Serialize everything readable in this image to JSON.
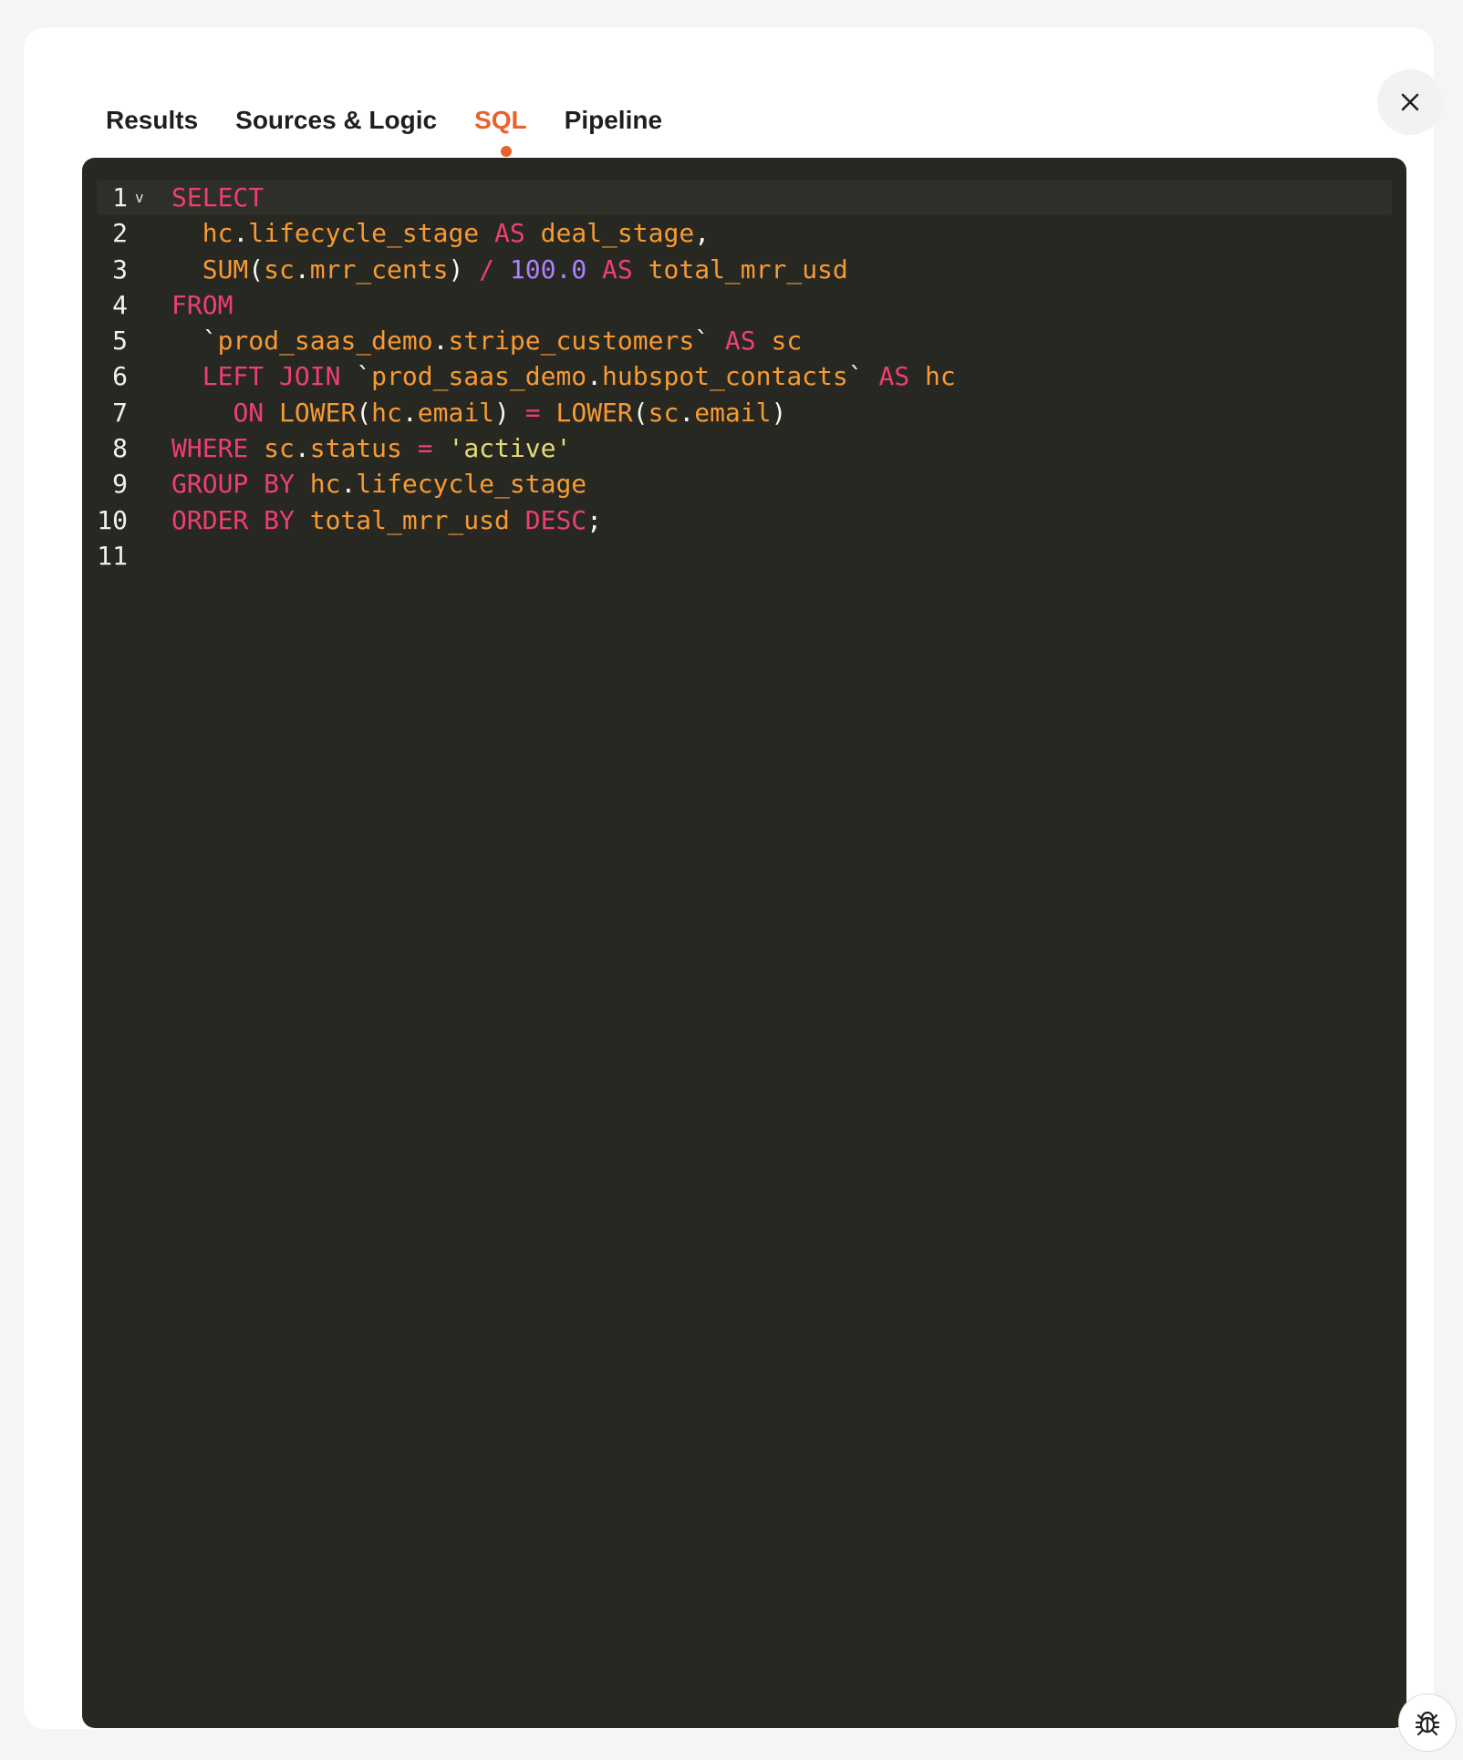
{
  "tabs": [
    {
      "label": "Results",
      "active": false
    },
    {
      "label": "Sources & Logic",
      "active": false
    },
    {
      "label": "SQL",
      "active": true
    },
    {
      "label": "Pipeline",
      "active": false
    }
  ],
  "icons": {
    "close": "close-icon",
    "fold": "chevron-down-icon",
    "debug": "bug-icon"
  },
  "colors": {
    "accent": "#e8622c",
    "editor_bg": "#272822",
    "keyword": "#ee3f73",
    "identifier": "#f79a33",
    "number": "#ae81ff",
    "string": "#e6db74",
    "punct": "#f8f8f2"
  },
  "editor": {
    "fold_marker": "v",
    "lines": [
      {
        "n": "1",
        "tokens": [
          {
            "t": "SELECT",
            "k": "kw"
          }
        ]
      },
      {
        "n": "2",
        "tokens": [
          {
            "t": "  ",
            "k": "pn"
          },
          {
            "t": "hc",
            "k": "id"
          },
          {
            "t": ".",
            "k": "pn"
          },
          {
            "t": "lifecycle_stage",
            "k": "id"
          },
          {
            "t": " ",
            "k": "pn"
          },
          {
            "t": "AS",
            "k": "kw"
          },
          {
            "t": " ",
            "k": "pn"
          },
          {
            "t": "deal_stage",
            "k": "id"
          },
          {
            "t": ",",
            "k": "pn"
          }
        ]
      },
      {
        "n": "3",
        "tokens": [
          {
            "t": "  ",
            "k": "pn"
          },
          {
            "t": "SUM",
            "k": "fn"
          },
          {
            "t": "(",
            "k": "pn"
          },
          {
            "t": "sc",
            "k": "id"
          },
          {
            "t": ".",
            "k": "pn"
          },
          {
            "t": "mrr_cents",
            "k": "id"
          },
          {
            "t": ") ",
            "k": "pn"
          },
          {
            "t": "/",
            "k": "kw"
          },
          {
            "t": " ",
            "k": "pn"
          },
          {
            "t": "100.0",
            "k": "num"
          },
          {
            "t": " ",
            "k": "pn"
          },
          {
            "t": "AS",
            "k": "kw"
          },
          {
            "t": " ",
            "k": "pn"
          },
          {
            "t": "total_mrr_usd",
            "k": "id"
          }
        ]
      },
      {
        "n": "4",
        "tokens": [
          {
            "t": "FROM",
            "k": "kw"
          }
        ]
      },
      {
        "n": "5",
        "tokens": [
          {
            "t": "  `",
            "k": "pn"
          },
          {
            "t": "prod_saas_demo",
            "k": "id"
          },
          {
            "t": ".",
            "k": "pn"
          },
          {
            "t": "stripe_customers",
            "k": "id"
          },
          {
            "t": "` ",
            "k": "pn"
          },
          {
            "t": "AS",
            "k": "kw"
          },
          {
            "t": " ",
            "k": "pn"
          },
          {
            "t": "sc",
            "k": "id"
          }
        ]
      },
      {
        "n": "6",
        "tokens": [
          {
            "t": "  ",
            "k": "pn"
          },
          {
            "t": "LEFT JOIN",
            "k": "kw"
          },
          {
            "t": " `",
            "k": "pn"
          },
          {
            "t": "prod_saas_demo",
            "k": "id"
          },
          {
            "t": ".",
            "k": "pn"
          },
          {
            "t": "hubspot_contacts",
            "k": "id"
          },
          {
            "t": "` ",
            "k": "pn"
          },
          {
            "t": "AS",
            "k": "kw"
          },
          {
            "t": " ",
            "k": "pn"
          },
          {
            "t": "hc",
            "k": "id"
          }
        ]
      },
      {
        "n": "7",
        "tokens": [
          {
            "t": "    ",
            "k": "pn"
          },
          {
            "t": "ON",
            "k": "kw"
          },
          {
            "t": " ",
            "k": "pn"
          },
          {
            "t": "LOWER",
            "k": "fn"
          },
          {
            "t": "(",
            "k": "pn"
          },
          {
            "t": "hc",
            "k": "id"
          },
          {
            "t": ".",
            "k": "pn"
          },
          {
            "t": "email",
            "k": "id"
          },
          {
            "t": ") ",
            "k": "pn"
          },
          {
            "t": "=",
            "k": "kw"
          },
          {
            "t": " ",
            "k": "pn"
          },
          {
            "t": "LOWER",
            "k": "fn"
          },
          {
            "t": "(",
            "k": "pn"
          },
          {
            "t": "sc",
            "k": "id"
          },
          {
            "t": ".",
            "k": "pn"
          },
          {
            "t": "email",
            "k": "id"
          },
          {
            "t": ")",
            "k": "pn"
          }
        ]
      },
      {
        "n": "8",
        "tokens": [
          {
            "t": "WHERE",
            "k": "kw"
          },
          {
            "t": " ",
            "k": "pn"
          },
          {
            "t": "sc",
            "k": "id"
          },
          {
            "t": ".",
            "k": "pn"
          },
          {
            "t": "status",
            "k": "id"
          },
          {
            "t": " ",
            "k": "pn"
          },
          {
            "t": "=",
            "k": "kw"
          },
          {
            "t": " ",
            "k": "pn"
          },
          {
            "t": "'active'",
            "k": "str"
          }
        ]
      },
      {
        "n": "9",
        "tokens": [
          {
            "t": "GROUP BY",
            "k": "kw"
          },
          {
            "t": " ",
            "k": "pn"
          },
          {
            "t": "hc",
            "k": "id"
          },
          {
            "t": ".",
            "k": "pn"
          },
          {
            "t": "lifecycle_stage",
            "k": "id"
          }
        ]
      },
      {
        "n": "10",
        "tokens": [
          {
            "t": "ORDER BY",
            "k": "kw"
          },
          {
            "t": " ",
            "k": "pn"
          },
          {
            "t": "total_mrr_usd",
            "k": "id"
          },
          {
            "t": " ",
            "k": "pn"
          },
          {
            "t": "DESC",
            "k": "kw"
          },
          {
            "t": ";",
            "k": "pn"
          }
        ]
      },
      {
        "n": "11",
        "tokens": []
      }
    ]
  }
}
